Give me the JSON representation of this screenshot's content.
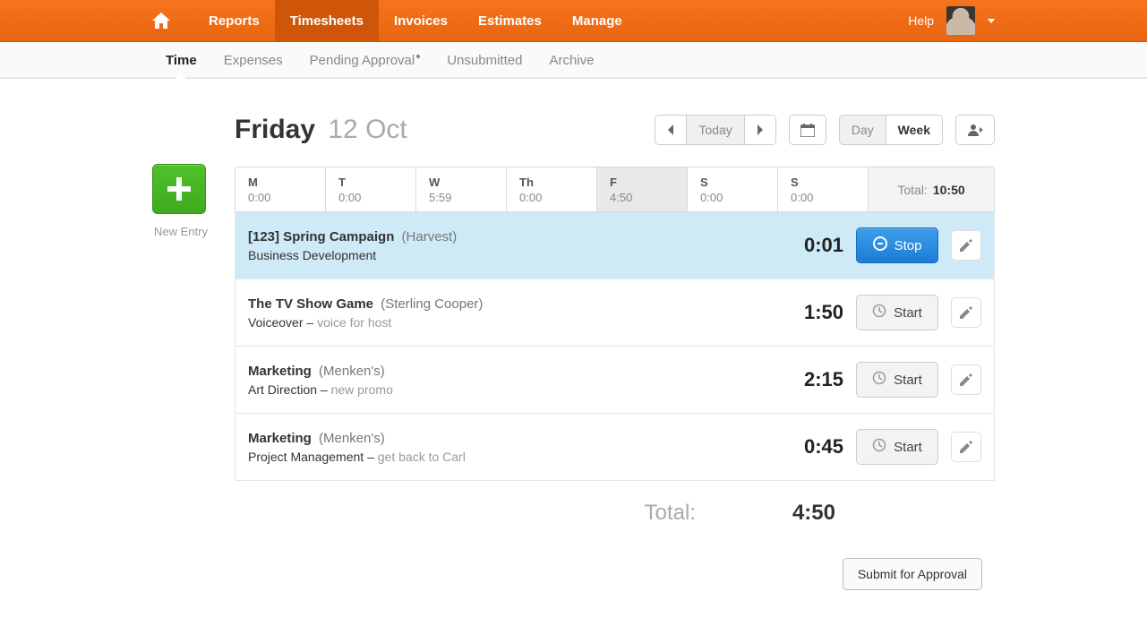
{
  "topnav": {
    "items": [
      "Reports",
      "Timesheets",
      "Invoices",
      "Estimates",
      "Manage"
    ],
    "active_index": 1,
    "help": "Help"
  },
  "subnav": {
    "items": [
      "Time",
      "Expenses",
      "Pending Approval",
      "Unsubmitted",
      "Archive"
    ],
    "active_index": 0,
    "indicator_index": 2
  },
  "page": {
    "day_name": "Friday",
    "date_label": "12 Oct",
    "new_entry_label": "New Entry"
  },
  "controls": {
    "today_label": "Today",
    "view_day": "Day",
    "view_week": "Week",
    "active_view": "Week"
  },
  "week": {
    "days": [
      {
        "abbr": "M",
        "time": "0:00"
      },
      {
        "abbr": "T",
        "time": "0:00"
      },
      {
        "abbr": "W",
        "time": "5:59"
      },
      {
        "abbr": "Th",
        "time": "0:00"
      },
      {
        "abbr": "F",
        "time": "4:50"
      },
      {
        "abbr": "S",
        "time": "0:00"
      },
      {
        "abbr": "S",
        "time": "0:00"
      }
    ],
    "selected_index": 4,
    "total_label": "Total:",
    "total_value": "10:50"
  },
  "entries": [
    {
      "project": "[123] Spring Campaign",
      "client": "(Harvest)",
      "task": "Business Development",
      "note": "",
      "time": "0:01",
      "running": true,
      "button_label": "Stop"
    },
    {
      "project": "The TV Show Game",
      "client": "(Sterling Cooper)",
      "task": "Voiceover",
      "note": "voice for host",
      "time": "1:50",
      "running": false,
      "button_label": "Start"
    },
    {
      "project": "Marketing",
      "client": "(Menken's)",
      "task": "Art Direction",
      "note": "new promo",
      "time": "2:15",
      "running": false,
      "button_label": "Start"
    },
    {
      "project": "Marketing",
      "client": "(Menken's)",
      "task": "Project Management",
      "note": "get back to Carl",
      "time": "0:45",
      "running": false,
      "button_label": "Start"
    }
  ],
  "day_total": {
    "label": "Total:",
    "value": "4:50"
  },
  "submit_label": "Submit for Approval"
}
